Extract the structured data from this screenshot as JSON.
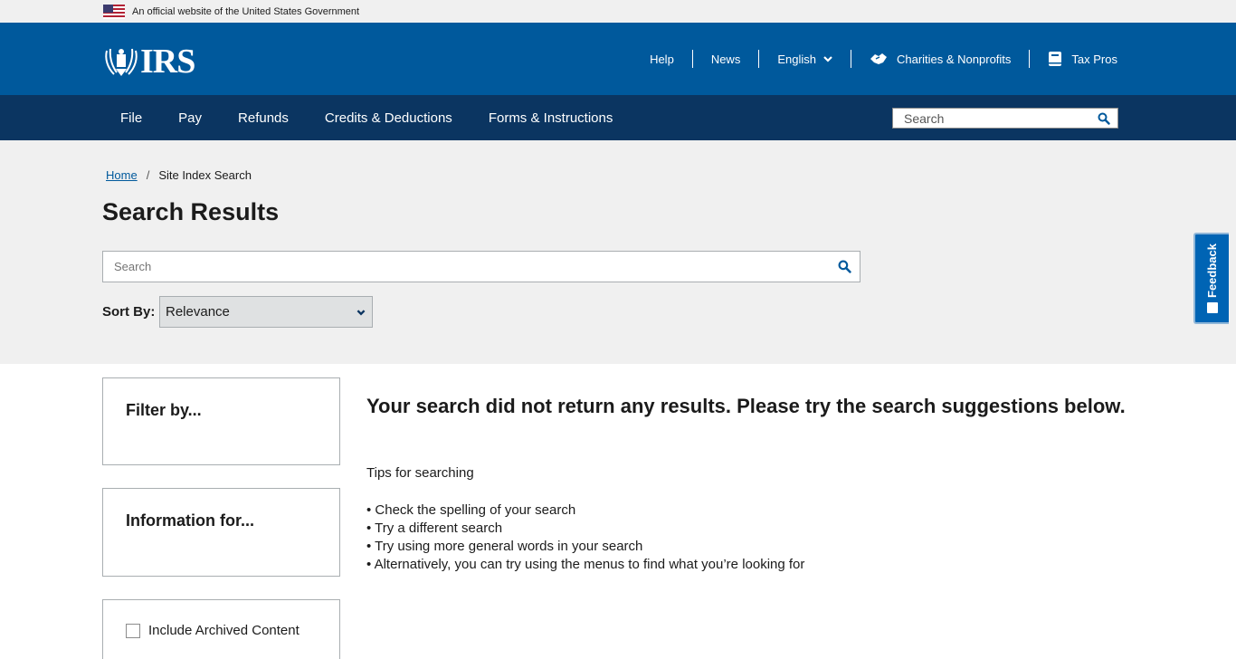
{
  "gov_banner": {
    "text": "An official website of the United States Government",
    "flag_icon": "us-flag-icon"
  },
  "header": {
    "logo_text": "IRS",
    "util_nav": [
      {
        "label": "Help"
      },
      {
        "label": "News"
      },
      {
        "label": "English"
      },
      {
        "label": "Charities & Nonprofits",
        "icon": "handshake-icon"
      },
      {
        "label": "Tax Pros",
        "icon": "book-icon"
      }
    ],
    "colors": {
      "header_bg": "#00599c",
      "nav_bg": "#0b3561"
    }
  },
  "main_nav": {
    "links": [
      "File",
      "Pay",
      "Refunds",
      "Credits & Deductions",
      "Forms & Instructions"
    ],
    "search_placeholder": "Search"
  },
  "breadcrumb": {
    "home": "Home",
    "separator": "/",
    "current": "Site Index Search"
  },
  "page_title": "Search Results",
  "search": {
    "placeholder": "Search",
    "value": ""
  },
  "sort": {
    "label": "Sort By:",
    "selected": "Relevance"
  },
  "sidebar": {
    "filter_title": "Filter by...",
    "info_title": "Information for...",
    "archived_label": "Include Archived Content",
    "archived_checked": false
  },
  "results": {
    "message": "Your search did not return any results. Please try the search suggestions below.",
    "tips_title": "Tips for searching",
    "tips": [
      "• Check the spelling of your search",
      "• Try a different search",
      "• Try using more general words in your search",
      "• Alternatively, you can try using the menus to find what you’re looking for"
    ]
  },
  "feedback": {
    "label": "Feedback"
  }
}
